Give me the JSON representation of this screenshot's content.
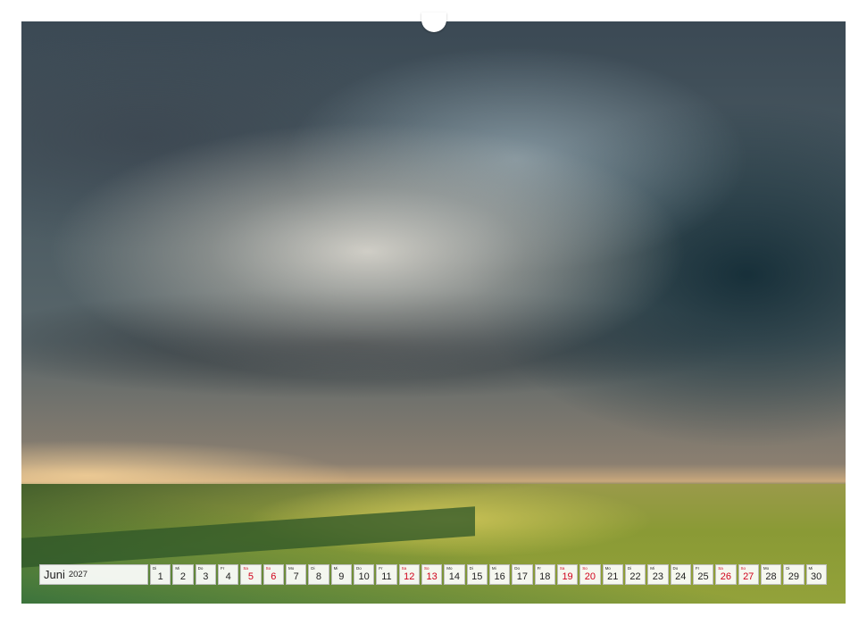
{
  "calendar": {
    "month": "Juni",
    "year": "2027",
    "days": [
      {
        "wd": "Di",
        "n": "1",
        "weekend": false
      },
      {
        "wd": "Mi",
        "n": "2",
        "weekend": false
      },
      {
        "wd": "Do",
        "n": "3",
        "weekend": false
      },
      {
        "wd": "Fr",
        "n": "4",
        "weekend": false
      },
      {
        "wd": "Sa",
        "n": "5",
        "weekend": true
      },
      {
        "wd": "So",
        "n": "6",
        "weekend": true
      },
      {
        "wd": "Mo",
        "n": "7",
        "weekend": false
      },
      {
        "wd": "Di",
        "n": "8",
        "weekend": false
      },
      {
        "wd": "Mi",
        "n": "9",
        "weekend": false
      },
      {
        "wd": "Do",
        "n": "10",
        "weekend": false
      },
      {
        "wd": "Fr",
        "n": "11",
        "weekend": false
      },
      {
        "wd": "Sa",
        "n": "12",
        "weekend": true
      },
      {
        "wd": "So",
        "n": "13",
        "weekend": true
      },
      {
        "wd": "Mo",
        "n": "14",
        "weekend": false
      },
      {
        "wd": "Di",
        "n": "15",
        "weekend": false
      },
      {
        "wd": "Mi",
        "n": "16",
        "weekend": false
      },
      {
        "wd": "Do",
        "n": "17",
        "weekend": false
      },
      {
        "wd": "Fr",
        "n": "18",
        "weekend": false
      },
      {
        "wd": "Sa",
        "n": "19",
        "weekend": true
      },
      {
        "wd": "So",
        "n": "20",
        "weekend": true
      },
      {
        "wd": "Mo",
        "n": "21",
        "weekend": false
      },
      {
        "wd": "Di",
        "n": "22",
        "weekend": false
      },
      {
        "wd": "Mi",
        "n": "23",
        "weekend": false
      },
      {
        "wd": "Do",
        "n": "24",
        "weekend": false
      },
      {
        "wd": "Fr",
        "n": "25",
        "weekend": false
      },
      {
        "wd": "Sa",
        "n": "26",
        "weekend": true
      },
      {
        "wd": "So",
        "n": "27",
        "weekend": true
      },
      {
        "wd": "Mo",
        "n": "28",
        "weekend": false
      },
      {
        "wd": "Di",
        "n": "29",
        "weekend": false
      },
      {
        "wd": "Mi",
        "n": "30",
        "weekend": false
      }
    ]
  },
  "colors": {
    "weekend": "#d0021b",
    "text": "#222222",
    "background": "#ffffff"
  }
}
